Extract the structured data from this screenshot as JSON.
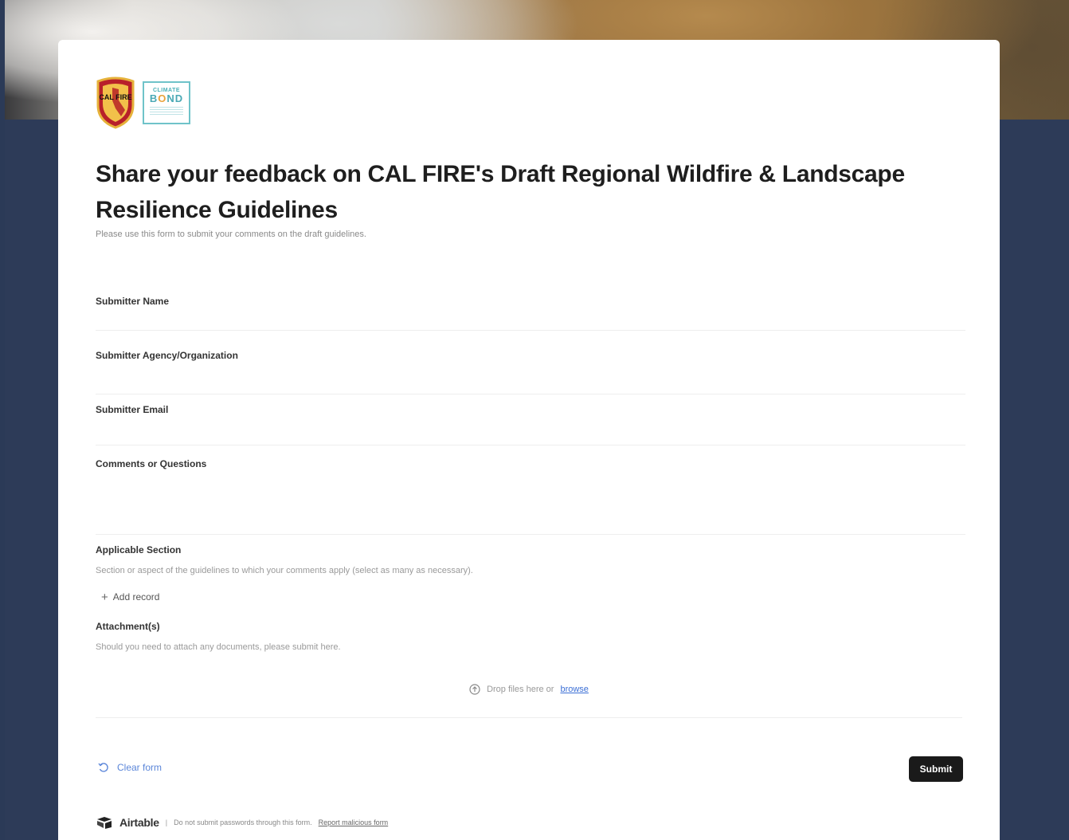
{
  "header": {
    "logos": [
      {
        "name": "calfire-logo",
        "text": "CAL FIRE"
      },
      {
        "name": "climate-bond-logo",
        "top": "CLIMATE",
        "main_before": "B",
        "main_o": "O",
        "main_after": "ND"
      }
    ]
  },
  "form": {
    "title": "Share your feedback on CAL FIRE's Draft Regional Wildfire & Landscape Resilience Guidelines",
    "description": "Please use this form to submit your comments on the draft guidelines.",
    "fields": [
      {
        "label": "Submitter Name",
        "value": ""
      },
      {
        "label": "Submitter Agency/Organization",
        "value": ""
      },
      {
        "label": "Submitter Email",
        "value": ""
      },
      {
        "label": "Comments or Questions",
        "value": ""
      },
      {
        "label": "Applicable Section",
        "description": "Section or aspect of the guidelines to which your comments apply (select as many as necessary).",
        "action": "Add record"
      },
      {
        "label": "Attachment(s)",
        "description": "Should you need to attach any documents, please submit here."
      }
    ],
    "dropzone": {
      "text": "Drop files here or",
      "link": "browse"
    },
    "clear_label": "Clear form",
    "submit_label": "Submit"
  },
  "footer": {
    "brand": "Airtable",
    "separator": "|",
    "notice": "Do not submit passwords through this form.",
    "report_link": "Report malicious form"
  },
  "colors": {
    "accent_link": "#5b86d9",
    "button_dark": "#1a1a1a",
    "page_bg": "#2d3b58"
  }
}
